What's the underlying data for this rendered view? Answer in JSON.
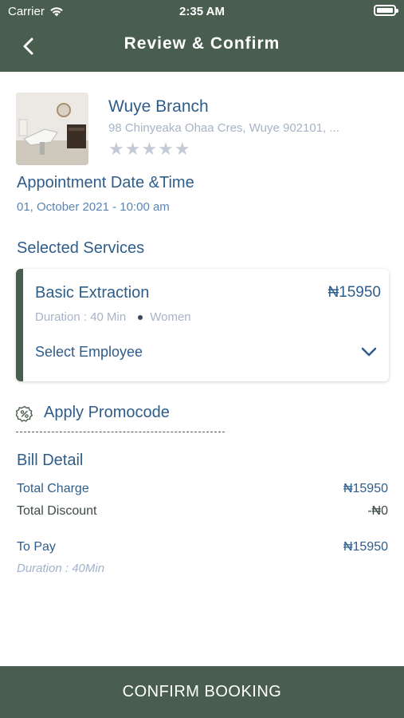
{
  "status_bar": {
    "carrier": "Carrier",
    "time": "2:35 AM"
  },
  "header": {
    "title": "Review & Confirm"
  },
  "branch": {
    "name": "Wuye Branch",
    "address": "98 Chinyeaka Ohaa Cres, Wuye 902101, ...",
    "rating": 0,
    "stars": "★★★★★"
  },
  "appointment": {
    "heading": "Appointment Date &Time",
    "value": "01, October 2021 - 10:00 am"
  },
  "services": {
    "heading": "Selected Services",
    "items": [
      {
        "name": "Basic Extraction",
        "price": "₦15950",
        "duration": "Duration : 40 Min",
        "gender": "Women",
        "select_employee_label": "Select Employee"
      }
    ]
  },
  "promo": {
    "label": "Apply Promocode"
  },
  "bill": {
    "heading": "Bill Detail",
    "total_charge_label": "Total Charge",
    "total_charge_value": "₦15950",
    "total_discount_label": "Total Discount",
    "total_discount_value": "-₦0",
    "to_pay_label": "To Pay",
    "to_pay_value": "₦15950",
    "duration": "Duration : 40Min"
  },
  "footer": {
    "confirm_label": "CONFIRM BOOKING"
  },
  "colors": {
    "header_bg": "#4a5e4f",
    "primary_text": "#2f5d8a",
    "muted_text": "#a7b4c6"
  }
}
